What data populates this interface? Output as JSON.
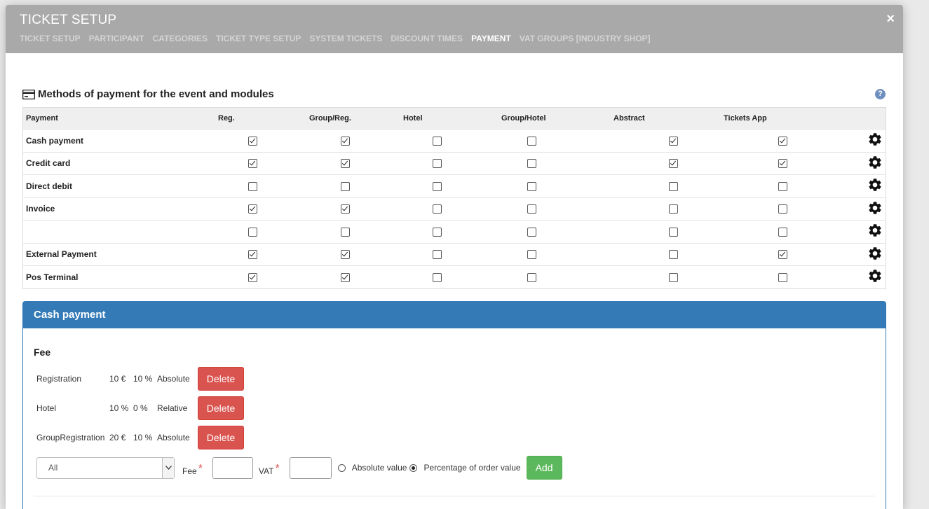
{
  "modal": {
    "title": "TICKET SETUP",
    "close_label": "×",
    "tabs": [
      {
        "label": "TICKET SETUP",
        "active": false
      },
      {
        "label": "PARTICIPANT",
        "active": false
      },
      {
        "label": "CATEGORIES",
        "active": false
      },
      {
        "label": "TICKET TYPE SETUP",
        "active": false
      },
      {
        "label": "SYSTEM TICKETS",
        "active": false
      },
      {
        "label": "DISCOUNT TIMES",
        "active": false
      },
      {
        "label": "PAYMENT",
        "active": true
      },
      {
        "label": "VAT GROUPS [INDUSTRY SHOP]",
        "active": false
      }
    ]
  },
  "methods": {
    "title": "Methods of payment for the event and modules",
    "help_label": "?",
    "columns": [
      "Payment",
      "Reg.",
      "Group/Reg.",
      "Hotel",
      "Group/Hotel",
      "Abstract",
      "Tickets App"
    ],
    "rows": [
      {
        "name": "Cash payment",
        "checks": [
          true,
          true,
          false,
          false,
          true,
          true
        ]
      },
      {
        "name": "Credit card",
        "checks": [
          true,
          true,
          false,
          false,
          true,
          true
        ]
      },
      {
        "name": "Direct debit",
        "checks": [
          false,
          false,
          false,
          false,
          false,
          false
        ]
      },
      {
        "name": "Invoice",
        "checks": [
          true,
          true,
          false,
          false,
          false,
          false
        ]
      },
      {
        "name": "",
        "checks": [
          false,
          false,
          false,
          false,
          false,
          false
        ]
      },
      {
        "name": "External Payment",
        "checks": [
          true,
          true,
          false,
          false,
          false,
          true
        ]
      },
      {
        "name": "Pos Terminal",
        "checks": [
          true,
          true,
          false,
          false,
          false,
          false
        ]
      }
    ]
  },
  "panel": {
    "title": "Cash payment",
    "fee_label": "Fee",
    "fees": [
      {
        "type": "Registration",
        "fee": "10 €",
        "vat": "10 %",
        "mode": "Absolute",
        "delete_label": "Delete"
      },
      {
        "type": "Hotel",
        "fee": "10 %",
        "vat": "0 %",
        "mode": "Relative",
        "delete_label": "Delete"
      },
      {
        "type": "GroupRegistration",
        "fee": "20 €",
        "vat": "10 %",
        "mode": "Absolute",
        "delete_label": "Delete"
      }
    ],
    "add": {
      "select_value": "All",
      "fee_label": "Fee",
      "vat_label": "VAT",
      "required_mark": "*",
      "absolute_label": "Absolute value",
      "percentage_label": "Percentage of order value",
      "selected_mode": "percentage",
      "add_label": "Add"
    }
  }
}
